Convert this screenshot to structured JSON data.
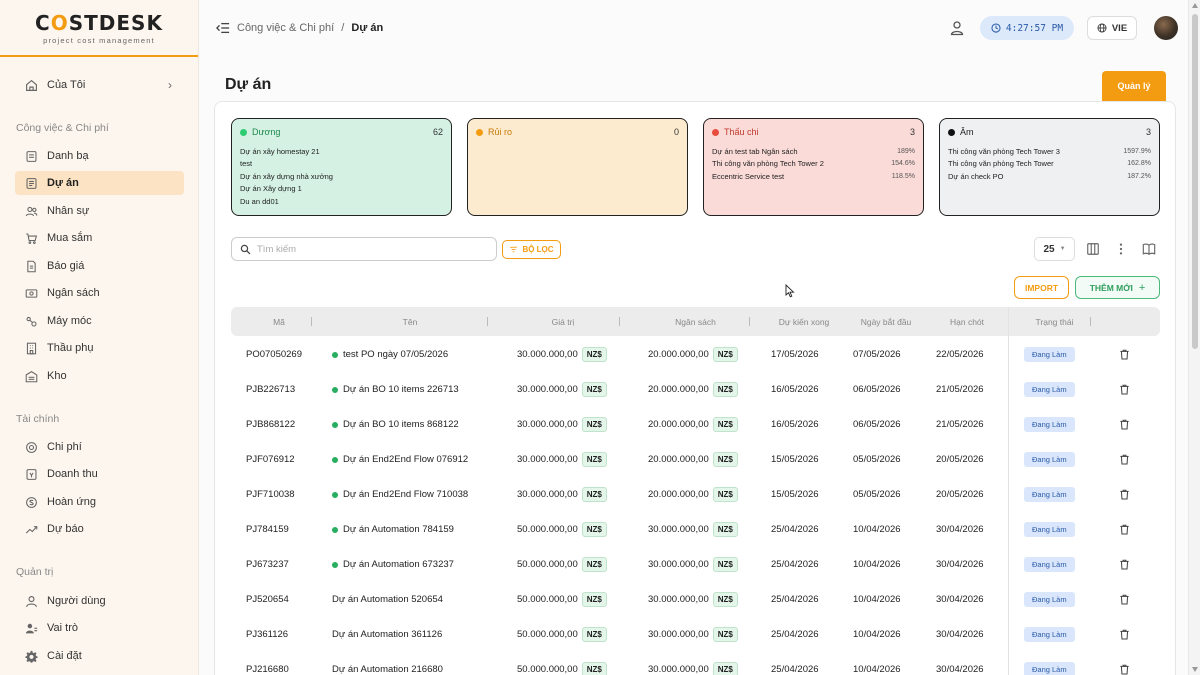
{
  "brand": {
    "name_prefix": "C",
    "name_o": "O",
    "name_suffix": "STDESK",
    "tagline": "project cost management"
  },
  "sidebar": {
    "top": {
      "label": "Của Tôi",
      "icon": "home-icon"
    },
    "sections": [
      {
        "title": "Công việc & Chi phí"
      },
      {
        "title": "Tài chính"
      },
      {
        "title": "Quản trị"
      }
    ],
    "items": [
      {
        "label": "Danh bạ",
        "icon": "contacts-icon"
      },
      {
        "label": "Dự án",
        "icon": "project-icon",
        "active": true
      },
      {
        "label": "Nhân sự",
        "icon": "people-icon"
      },
      {
        "label": "Mua sắm",
        "icon": "cart-icon"
      },
      {
        "label": "Báo giá",
        "icon": "quote-icon"
      },
      {
        "label": "Ngân sách",
        "icon": "budget-icon"
      },
      {
        "label": "Máy móc",
        "icon": "machine-icon"
      },
      {
        "label": "Thầu phụ",
        "icon": "building-icon"
      },
      {
        "label": "Kho",
        "icon": "warehouse-icon"
      },
      {
        "label": "Chi phí",
        "icon": "coin-icon"
      },
      {
        "label": "Doanh thu",
        "icon": "revenue-icon"
      },
      {
        "label": "Hoàn ứng",
        "icon": "refund-icon"
      },
      {
        "label": "Dự báo",
        "icon": "trend-icon"
      },
      {
        "label": "Người dùng",
        "icon": "user-icon"
      },
      {
        "label": "Vai trò",
        "icon": "role-icon"
      },
      {
        "label": "Cài đặt",
        "icon": "gear-icon"
      }
    ]
  },
  "header": {
    "breadcrumb_parent": "Công việc & Chi phí",
    "breadcrumb_sep": "/",
    "breadcrumb_current": "Dự án",
    "clock": "4:27:57 PM",
    "language": "VIE"
  },
  "page": {
    "title": "Dự án",
    "manage_label": "Quản lý"
  },
  "status_boxes": [
    {
      "title": "Dương",
      "count": "62",
      "color": "#2ecc71",
      "bg": "#d4f1e3",
      "items": [
        {
          "name": "Dự án xây homestay 21",
          "pct": ""
        },
        {
          "name": "test",
          "pct": ""
        },
        {
          "name": "Dự án xây dựng nhà xưởng",
          "pct": ""
        },
        {
          "name": "Dự án Xây dựng 1",
          "pct": ""
        },
        {
          "name": "Du an dd01",
          "pct": ""
        }
      ]
    },
    {
      "title": "Rủi ro",
      "count": "0",
      "color": "#f39c12",
      "bg": "#fdebd0",
      "items": []
    },
    {
      "title": "Thấu chi",
      "count": "3",
      "color": "#e74c3c",
      "bg": "#fadbd8",
      "items": [
        {
          "name": "Dự án test tab Ngân sách",
          "pct": "189%"
        },
        {
          "name": "Thi công văn phòng Tech Tower 2",
          "pct": "154.6%"
        },
        {
          "name": "Eccentric Service test",
          "pct": "118.5%"
        }
      ]
    },
    {
      "title": "Âm",
      "count": "3",
      "color": "#111111",
      "bg": "#eef0f2",
      "items": [
        {
          "name": "Thi công văn phòng Tech Tower 3",
          "pct": "1597.9%"
        },
        {
          "name": "Thi công văn phòng Tech Tower",
          "pct": "162.8%"
        },
        {
          "name": "Dự án check PO",
          "pct": "187.2%"
        }
      ]
    }
  ],
  "toolbar": {
    "search_placeholder": "Tìm kiếm",
    "filter_label": "BỘ LỌC",
    "page_size": "25",
    "import_label": "IMPORT",
    "add_label": "THÊM MỚI",
    "add_plus": "+"
  },
  "table": {
    "columns": [
      "Mã",
      "Tên",
      "Giá trị",
      "Ngân sách",
      "Dự kiến xong",
      "Ngày bắt đầu",
      "Hạn chót",
      "Trạng thái"
    ],
    "currency": "NZ$",
    "rows": [
      {
        "code": "PO07050269",
        "name": "test PO ngày 07/05/2026",
        "dot": true,
        "value": "30.000.000,00",
        "budget": "20.000.000,00",
        "expected": "17/05/2026",
        "start": "07/05/2026",
        "deadline": "22/05/2026",
        "status": "Đang Làm"
      },
      {
        "code": "PJB226713",
        "name": "Dự án BO 10 items 226713",
        "dot": true,
        "value": "30.000.000,00",
        "budget": "20.000.000,00",
        "expected": "16/05/2026",
        "start": "06/05/2026",
        "deadline": "21/05/2026",
        "status": "Đang Làm"
      },
      {
        "code": "PJB868122",
        "name": "Dự án BO 10 items 868122",
        "dot": true,
        "value": "30.000.000,00",
        "budget": "20.000.000,00",
        "expected": "16/05/2026",
        "start": "06/05/2026",
        "deadline": "21/05/2026",
        "status": "Đang Làm"
      },
      {
        "code": "PJF076912",
        "name": "Dự án End2End Flow 076912",
        "dot": true,
        "value": "30.000.000,00",
        "budget": "20.000.000,00",
        "expected": "15/05/2026",
        "start": "05/05/2026",
        "deadline": "20/05/2026",
        "status": "Đang Làm"
      },
      {
        "code": "PJF710038",
        "name": "Dự án End2End Flow 710038",
        "dot": true,
        "value": "30.000.000,00",
        "budget": "20.000.000,00",
        "expected": "15/05/2026",
        "start": "05/05/2026",
        "deadline": "20/05/2026",
        "status": "Đang Làm"
      },
      {
        "code": "PJ784159",
        "name": "Dự án Automation 784159",
        "dot": true,
        "value": "50.000.000,00",
        "budget": "30.000.000,00",
        "expected": "25/04/2026",
        "start": "10/04/2026",
        "deadline": "30/04/2026",
        "status": "Đang Làm"
      },
      {
        "code": "PJ673237",
        "name": "Dự án Automation 673237",
        "dot": true,
        "value": "50.000.000,00",
        "budget": "30.000.000,00",
        "expected": "25/04/2026",
        "start": "10/04/2026",
        "deadline": "30/04/2026",
        "status": "Đang Làm"
      },
      {
        "code": "PJ520654",
        "name": "Dự án Automation 520654",
        "dot": false,
        "value": "50.000.000,00",
        "budget": "30.000.000,00",
        "expected": "25/04/2026",
        "start": "10/04/2026",
        "deadline": "30/04/2026",
        "status": "Đang Làm"
      },
      {
        "code": "PJ361126",
        "name": "Dự án Automation 361126",
        "dot": false,
        "value": "50.000.000,00",
        "budget": "30.000.000,00",
        "expected": "25/04/2026",
        "start": "10/04/2026",
        "deadline": "30/04/2026",
        "status": "Đang Làm"
      },
      {
        "code": "PJ216680",
        "name": "Dự án Automation 216680",
        "dot": false,
        "value": "50.000.000,00",
        "budget": "30.000.000,00",
        "expected": "25/04/2026",
        "start": "10/04/2026",
        "deadline": "30/04/2026",
        "status": "Đang Làm"
      }
    ]
  }
}
